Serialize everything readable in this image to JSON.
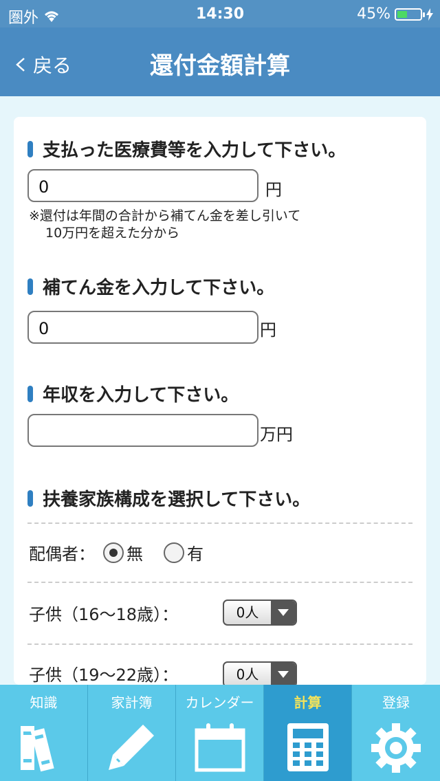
{
  "status": {
    "carrier": "圏外",
    "time": "14:30",
    "battery": "45%",
    "battery_level": 0.45
  },
  "nav": {
    "back": "戻る",
    "title": "還付金額計算"
  },
  "sections": {
    "medical": {
      "title": "支払った医療費等を入力して下さい。",
      "value": "0",
      "unit": "円",
      "note_line1": "※還付は年間の合計から補てん金を差し引いて",
      "note_line2": "10万円を超えた分から"
    },
    "compensation": {
      "title": "補てん金を入力して下さい。",
      "value": "0",
      "unit": "円"
    },
    "income": {
      "title": "年収を入力して下さい。",
      "value": "",
      "unit": "万円"
    },
    "family": {
      "title": "扶養家族構成を選択して下さい。"
    }
  },
  "family": {
    "spouse_label": "配偶者：",
    "spouse_no": "無",
    "spouse_yes": "有",
    "child1_label": "子供（16～18歳）：",
    "child1_value": "0人",
    "child2_label": "子供（19～22歳）：",
    "child2_value": "0人"
  },
  "tabs": [
    {
      "label": "知識"
    },
    {
      "label": "家計簿"
    },
    {
      "label": "カレンダー"
    },
    {
      "label": "計算"
    },
    {
      "label": "登録"
    }
  ],
  "colors": {
    "nav": "#4a8bc2",
    "tab": "#5bc9e9",
    "tab_active": "#2e9ccf",
    "active_label": "#f4e35a"
  }
}
